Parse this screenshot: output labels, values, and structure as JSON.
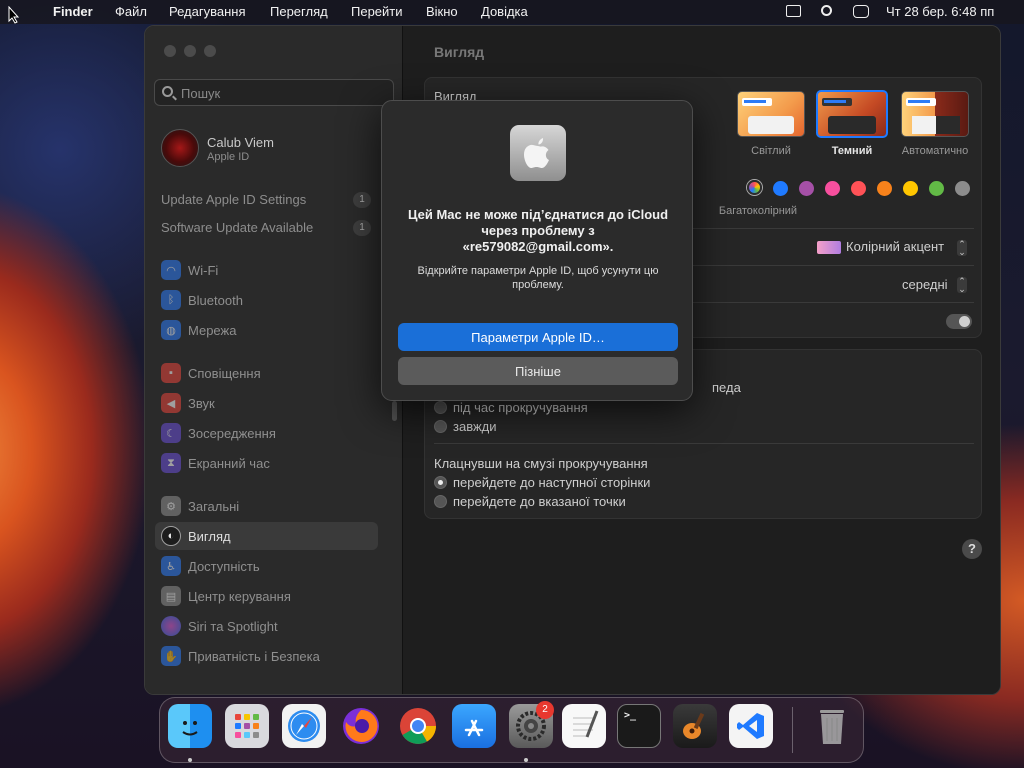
{
  "menubar": {
    "app_name": "Finder",
    "menus": [
      "Файл",
      "Редагування",
      "Перегляд",
      "Перейти",
      "Вікно",
      "Довідка"
    ],
    "datetime": "Чт 28 бер.  6:48 пп"
  },
  "sidebar": {
    "search_placeholder": "Пошук",
    "user_name": "Calub Viem",
    "user_sub": "Apple ID",
    "updates": [
      {
        "label": "Update Apple ID Settings",
        "count": "1"
      },
      {
        "label": "Software Update Available",
        "count": "1"
      }
    ],
    "items": [
      {
        "label": "Wi-Fi",
        "icon": "wifi-icon",
        "color": "#2d7bf6"
      },
      {
        "label": "Bluetooth",
        "icon": "bluetooth-icon",
        "color": "#2d7bf6"
      },
      {
        "label": "Мережа",
        "icon": "network-icon",
        "color": "#2d7bf6"
      },
      {
        "label": "Сповіщення",
        "icon": "notifications-icon",
        "color": "#e8453c"
      },
      {
        "label": "Звук",
        "icon": "sound-icon",
        "color": "#e8453c"
      },
      {
        "label": "Зосередження",
        "icon": "focus-icon",
        "color": "#6a4fd8"
      },
      {
        "label": "Екранний час",
        "icon": "screen-time-icon",
        "color": "#6a4fd8"
      },
      {
        "label": "Загальні",
        "icon": "general-icon",
        "color": "#8e8e8e"
      },
      {
        "label": "Вигляд",
        "icon": "appearance-icon",
        "color": "#2a2a2a"
      },
      {
        "label": "Доступність",
        "icon": "accessibility-icon",
        "color": "#2d7bf6"
      },
      {
        "label": "Центр керування",
        "icon": "control-center-icon",
        "color": "#8e8e8e"
      },
      {
        "label": "Siri та Spotlight",
        "icon": "siri-icon",
        "color": "#c94fd8"
      },
      {
        "label": "Приватність і Безпека",
        "icon": "privacy-icon",
        "color": "#2d7bf6"
      }
    ]
  },
  "main": {
    "title": "Вигляд",
    "appearance_label": "Вигляд",
    "themes": [
      "Світлий",
      "Темний",
      "Автоматично"
    ],
    "accent_caption": "Багатоколірний",
    "accent_colors": [
      "#ffffff",
      "#1f7aff",
      "#a550a7",
      "#f74f9e",
      "#ff5257",
      "#f7821b",
      "#ffc600",
      "#62ba46",
      "#8c8c8c"
    ],
    "highlight_value": "Колірний акцент",
    "sidebar_size_value": "середні",
    "scroll_partial": "педа",
    "scroll_options": [
      "під час прокручування",
      "завжди"
    ],
    "click_label": "Клацнувши на смузі прокручування",
    "click_options": [
      "перейдете до наступної сторінки",
      "перейдете до вказаної точки"
    ],
    "help": "?"
  },
  "dialog": {
    "title": "Цей Mac не може під’єднатися до iCloud через проблему з «re579082@gmail.com».",
    "message": "Відкрийте параметри Apple ID, щоб усунути цю проблему.",
    "primary_button": "Параметри Apple ID…",
    "secondary_button": "Пізніше"
  },
  "dock": {
    "apps": [
      "Finder",
      "Launchpad",
      "Safari",
      "Firefox",
      "Chrome",
      "App Store",
      "System Settings",
      "TextEdit",
      "Terminal",
      "GarageBand",
      "Visual Studio Code",
      "Trash"
    ],
    "settings_badge": "2"
  }
}
